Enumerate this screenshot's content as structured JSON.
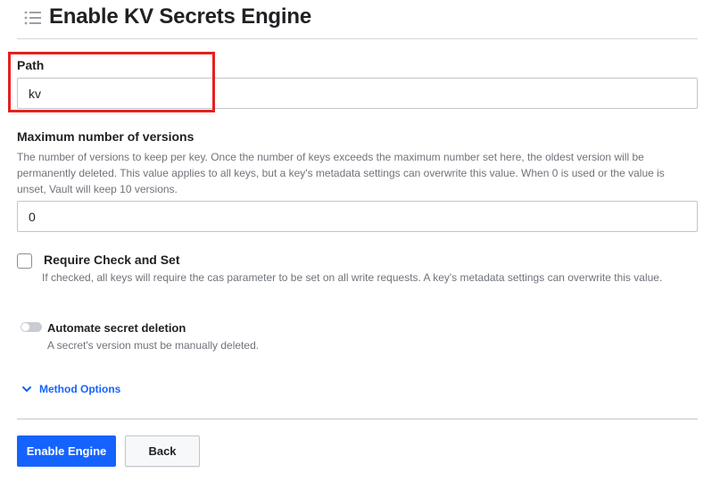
{
  "header": {
    "title": "Enable KV Secrets Engine",
    "icon": "list-icon"
  },
  "path": {
    "label": "Path",
    "value": "kv"
  },
  "max_versions": {
    "label": "Maximum number of versions",
    "help": "The number of versions to keep per key. Once the number of keys exceeds the maximum number set here, the oldest version will be permanently deleted. This value applies to all keys, but a key's metadata settings can overwrite this value. When 0 is used or the value is unset, Vault will keep 10 versions.",
    "value": "0"
  },
  "cas": {
    "label": "Require Check and Set",
    "help": "If checked, all keys will require the cas parameter to be set on all write requests. A key's metadata settings can overwrite this value.",
    "checked": false
  },
  "auto_delete": {
    "label": "Automate secret deletion",
    "help": "A secret's version must be manually deleted.",
    "enabled": false
  },
  "method_options": {
    "label": "Method Options",
    "icon": "chevron-down-icon"
  },
  "actions": {
    "enable_label": "Enable Engine",
    "back_label": "Back"
  },
  "colors": {
    "accent": "#1563ff",
    "highlight": "#e5201f"
  }
}
